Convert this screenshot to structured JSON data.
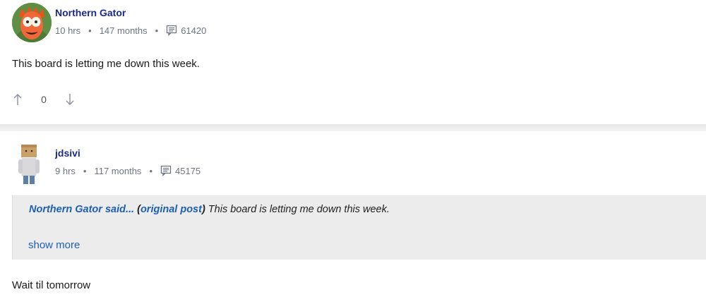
{
  "posts": [
    {
      "username": "Northern Gator",
      "time": "10 hrs",
      "tenure": "147 months",
      "post_count": "61420",
      "body": "This board is letting me down this week.",
      "votes": "0"
    },
    {
      "username": "jdsivi",
      "time": "9 hrs",
      "tenure": "117 months",
      "post_count": "45175",
      "quote": {
        "author": "Northern Gator said...",
        "open_paren": "(",
        "link_label": "original post",
        "close_paren": ")",
        "text": " This board is letting me down this week.",
        "show_more": "show more"
      },
      "body": "Wait til tomorrow"
    }
  ],
  "meta": {
    "separator": "•"
  },
  "icons": {
    "posts": "posts-icon",
    "upvote": "arrow-up-icon",
    "downvote": "arrow-down-icon"
  },
  "colors": {
    "username": "#1b2a8a",
    "link": "#1e5fb4",
    "quote_bg": "#ececec"
  }
}
